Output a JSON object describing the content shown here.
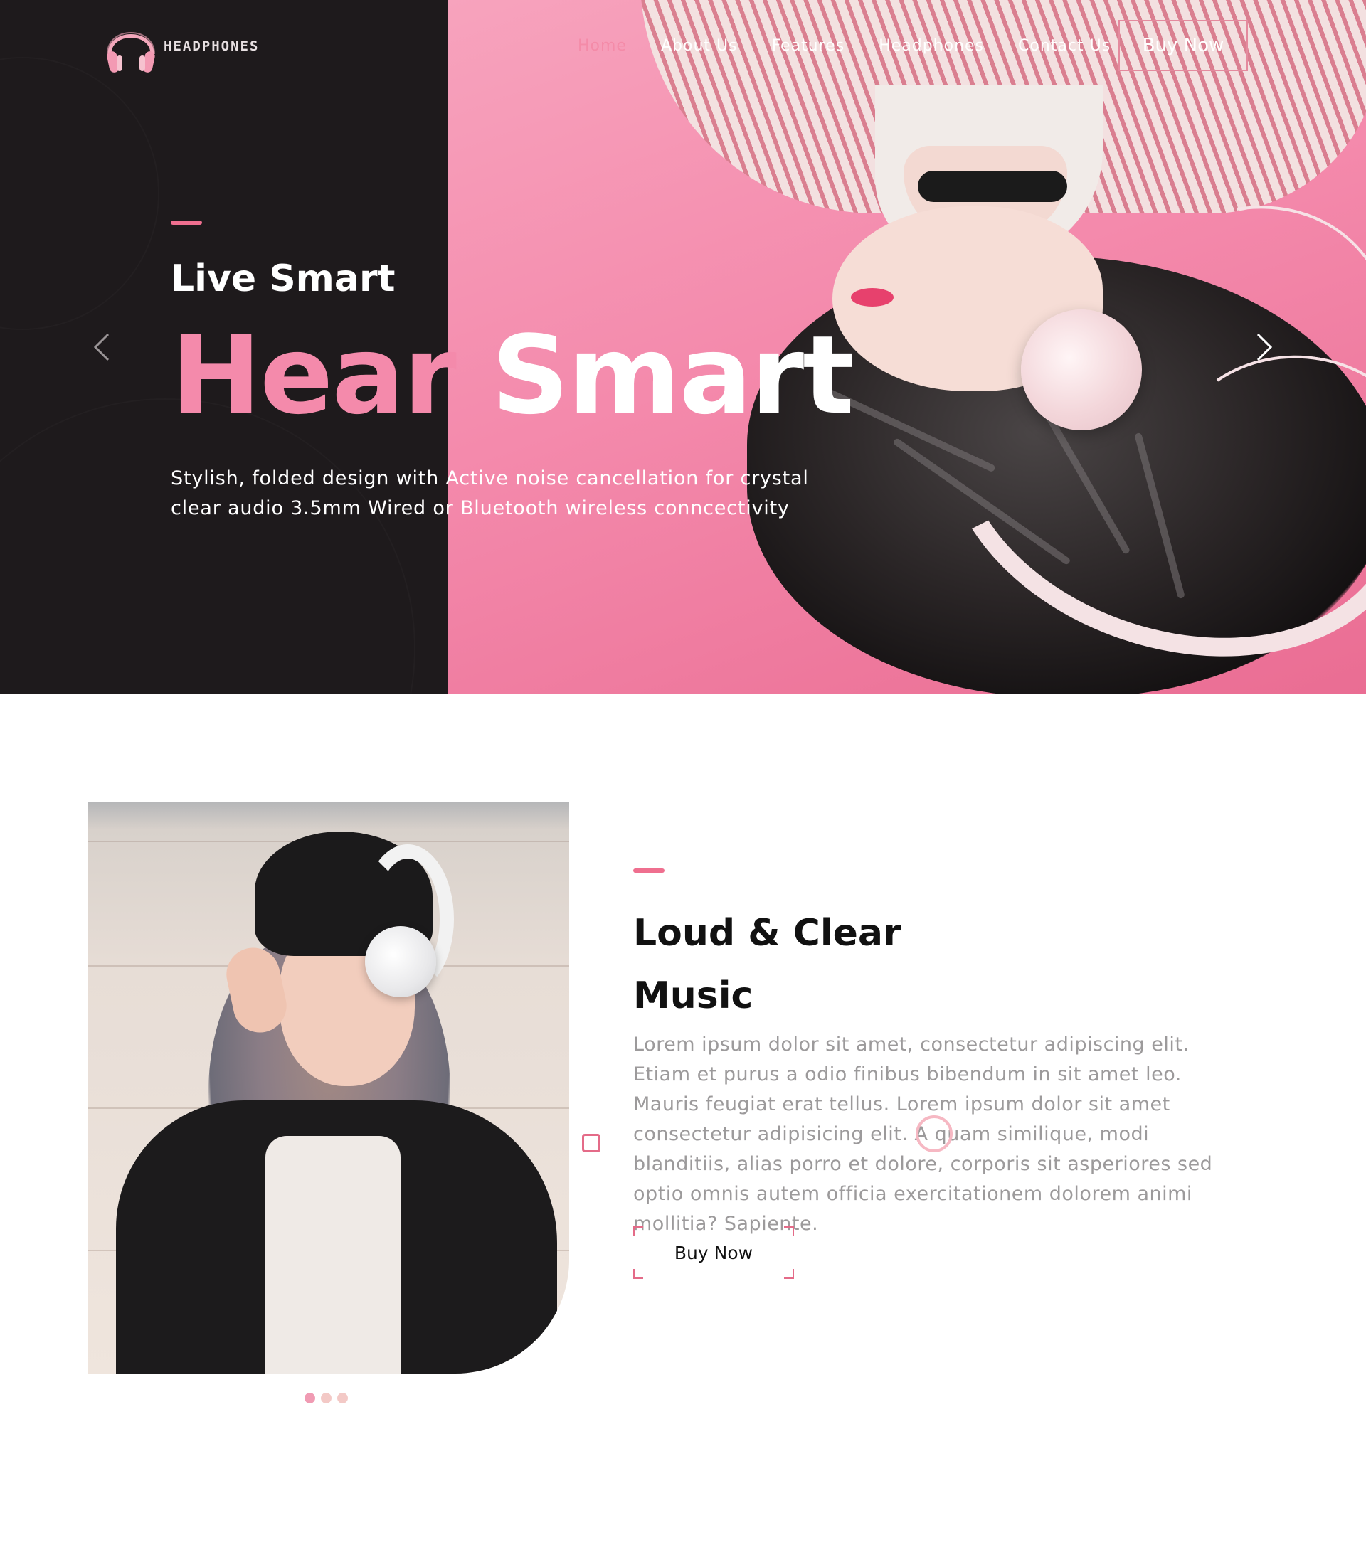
{
  "brand": {
    "name": "HEADPHONES",
    "logo_icon": "headphones-icon",
    "accent_color": "#f48aab",
    "dark_color": "#1e1a1c"
  },
  "nav": {
    "items": [
      {
        "label": "Home",
        "active": true
      },
      {
        "label": "About Us",
        "active": false
      },
      {
        "label": "Features",
        "active": false
      },
      {
        "label": "Headphones",
        "active": false
      },
      {
        "label": "Contact Us",
        "active": false
      }
    ],
    "cta_label": "Buy Now"
  },
  "hero": {
    "subtitle": "Live Smart",
    "title_part1": "Hear",
    "title_part2": "Smart",
    "description": "Stylish, folded design with Active noise cancellation for crystal clear audio 3.5mm Wired or Bluetooth wireless conncectivity",
    "prev_icon": "chevron-left-icon",
    "next_icon": "chevron-right-icon"
  },
  "about": {
    "title_line1": "Loud & Clear",
    "title_line2": "Music",
    "text": "Lorem ipsum dolor sit amet, consectetur adipiscing elit. Etiam et purus a odio finibus bibendum in sit amet leo. Mauris feugiat erat tellus. Lorem ipsum dolor sit amet consectetur adipisicing elit. A quam similique, modi blanditiis, alias porro et dolore, corporis sit asperiores sed optio omnis autem officia exercitationem dolorem animi mollitia? Sapiente.",
    "button_label": "Buy Now",
    "slider_dots": 3,
    "active_dot": 0
  }
}
